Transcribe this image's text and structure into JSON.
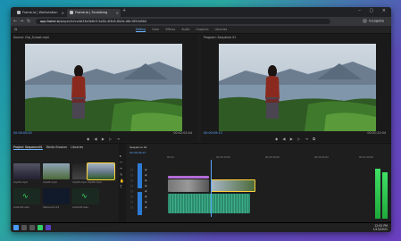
{
  "browser": {
    "tabs": [
      {
        "label": "Frame.io | Workstation",
        "active": false
      },
      {
        "label": "Frame.io | Scrubbing",
        "active": true
      }
    ],
    "url_domain": "app.frame.io",
    "url_path": "/player/b2ca4b33a0b8c9-5a84-4f4b5-8b0e-d8c1650d5b0",
    "profile": "Incognito"
  },
  "app": {
    "menu": [
      "Editing",
      "Color",
      "Effects",
      "Audio",
      "Graphics",
      "Libraries"
    ],
    "active_menu": "Editing"
  },
  "source_monitor": {
    "label": "Source: Clip_Sunset.mp4",
    "timecode": "00:00:00:00",
    "timecode_right": "00:02:02:04"
  },
  "program_monitor": {
    "label": "Program: Sequence 01",
    "timecode": "00:00:09:13",
    "timecode_right": "00:01:22:04"
  },
  "project_panel": {
    "tabs": [
      "Project: Sequence01",
      "Media Browser",
      "Libraries"
    ],
    "clips": [
      {
        "name": "clip01.mp4"
      },
      {
        "name": "clip02.mp4"
      },
      {
        "name": "clip03.mp4"
      },
      {
        "name": "clip04.mp4"
      },
      {
        "name": "Audio01.wav"
      },
      {
        "name": "Sequence 01"
      },
      {
        "name": "Audio02.wav"
      }
    ]
  },
  "timeline": {
    "label": "Sequence 01",
    "timecode": "00:00:09:13",
    "ruler": [
      "00:00",
      "00:00:15:00",
      "00:00:30:00",
      "00:00:45:00",
      "00:01:00:00"
    ]
  },
  "taskbar": {
    "time": "12:05 PM",
    "date": "1/15/2021"
  },
  "colors": {
    "accent": "#5aa8ff",
    "selection": "#ffd23c",
    "audio_green": "#3fe065",
    "video_purple": "#b46cd6",
    "audio_teal": "#2c8b6e"
  }
}
